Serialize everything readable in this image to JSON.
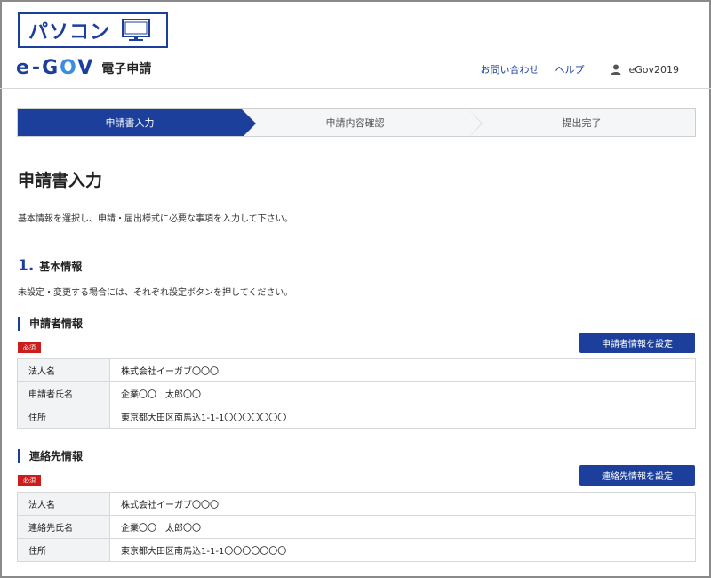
{
  "badge": {
    "label": "パソコン",
    "icon": "monitor-icon"
  },
  "brand": {
    "logo_e": "e",
    "logo_dash": "-",
    "logo_g": "G",
    "logo_o": "O",
    "logo_v": "V",
    "service": "電子申請",
    "accent": "#1b3f9a"
  },
  "nav": {
    "contact": "お問い合わせ",
    "help": "ヘルプ",
    "user": "eGov2019"
  },
  "steps": [
    {
      "label": "申請書入力"
    },
    {
      "label": "申請内容確認"
    },
    {
      "label": "提出完了"
    }
  ],
  "page": {
    "title": "申請書入力",
    "intro": "基本情報を選択し、申請・届出様式に必要な事項を入力して下さい。"
  },
  "section1": {
    "number": "1.",
    "title": "基本情報",
    "note": "未設定・変更する場合には、それぞれ設定ボタンを押してください。"
  },
  "applicant": {
    "heading": "申請者情報",
    "required": "必須",
    "button": "申請者情報を設定",
    "rows": [
      {
        "key": "法人名",
        "value": "株式会社イーガブ〇〇〇"
      },
      {
        "key": "申請者氏名",
        "value": "企業〇〇　太郎〇〇"
      },
      {
        "key": "住所",
        "value": "東京都大田区南馬込1-1-1〇〇〇〇〇〇〇"
      }
    ]
  },
  "contact": {
    "heading": "連絡先情報",
    "required": "必須",
    "button": "連絡先情報を設定",
    "rows": [
      {
        "key": "法人名",
        "value": "株式会社イーガブ〇〇〇"
      },
      {
        "key": "連絡先氏名",
        "value": "企業〇〇　太郎〇〇"
      },
      {
        "key": "住所",
        "value": "東京都大田区南馬込1-1-1〇〇〇〇〇〇〇"
      }
    ]
  }
}
